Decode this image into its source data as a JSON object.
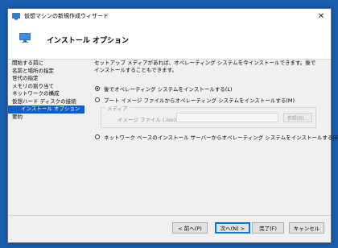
{
  "window": {
    "title": "仮想マシンの新規作成ウィザード",
    "close_glyph": "✕"
  },
  "header": {
    "title": "インストール オプション"
  },
  "nav": {
    "items": [
      {
        "label": "開始する前に"
      },
      {
        "label": "名前と場所の指定"
      },
      {
        "label": "世代の指定"
      },
      {
        "label": "メモリの割り当て"
      },
      {
        "label": "ネットワークの構成"
      },
      {
        "label": "仮想ハード ディスクの接続"
      },
      {
        "label": "インストール オプション"
      },
      {
        "label": "要約"
      }
    ],
    "selected_index": 6
  },
  "content": {
    "description": "セットアップ メディアがあれば、オペレーティング システムを今インストールできます。後でインストールすることもできます。",
    "options": [
      {
        "label": "後でオペレーティング システムをインストールする(L)",
        "checked": true
      },
      {
        "label": "ブート イメージ ファイルからオペレーティング システムをインストールする(M)",
        "checked": false
      },
      {
        "label": "ネットワーク ベースのインストール サーバーからオペレーティング システムをインストールする(E)",
        "checked": false
      }
    ],
    "media": {
      "legend": "メディア",
      "file_label": "イメージ ファイル (.iso)(I):",
      "file_value": "",
      "browse_label": "参照(B)..."
    }
  },
  "buttons": {
    "back": "< 前へ(P)",
    "next": "次へ(N) >",
    "finish": "完了(F)",
    "cancel": "キャンセル"
  },
  "colors": {
    "desktop": "#1b5fb0",
    "selection": "#0a5fc8"
  }
}
